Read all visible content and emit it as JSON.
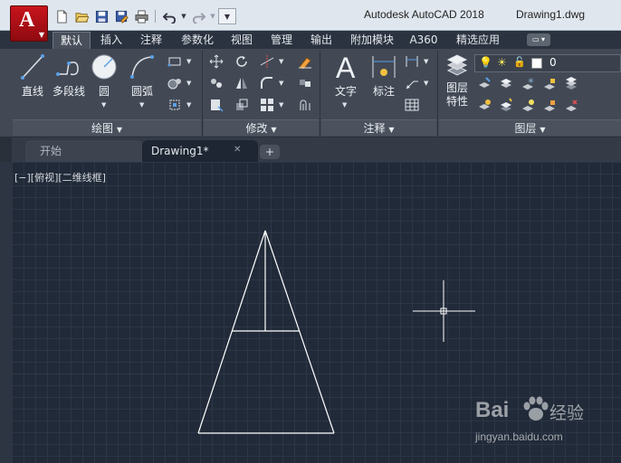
{
  "app": {
    "button_letter": "A",
    "title": "Autodesk AutoCAD 2018",
    "file_name": "Drawing1.dwg"
  },
  "quick_access": [
    "new-icon",
    "open-icon",
    "save-icon",
    "save-as-icon",
    "plot-icon",
    "undo-icon",
    "redo-icon",
    "customize-icon"
  ],
  "ribbon_tabs": [
    "默认",
    "插入",
    "注释",
    "参数化",
    "视图",
    "管理",
    "输出",
    "附加模块",
    "A360",
    "精选应用"
  ],
  "ribbon_tab_extra": "▭ ▾",
  "panels": {
    "draw": {
      "title": "绘图",
      "tools": [
        "直线",
        "多段线",
        "圆",
        "圆弧"
      ]
    },
    "modify": {
      "title": "修改"
    },
    "annotation": {
      "title": "注释",
      "tools": [
        "文字",
        "标注"
      ]
    },
    "layers": {
      "title": "图层",
      "tool_line1": "图层",
      "tool_line2": "特性",
      "current_layer": "0"
    }
  },
  "file_tabs": {
    "start": "开始",
    "drawing": "Drawing1*",
    "close": "✕",
    "add": "+"
  },
  "viewport_label": "[−][俯视][二维线框]",
  "colors": {
    "canvas": "#212a38",
    "ribbon": "#424955",
    "geometry": "#ffffff",
    "app_button": "#c8141c"
  },
  "watermark": {
    "brand": "Bai",
    "cn": "经验",
    "url": "jingyan.baidu.com"
  }
}
